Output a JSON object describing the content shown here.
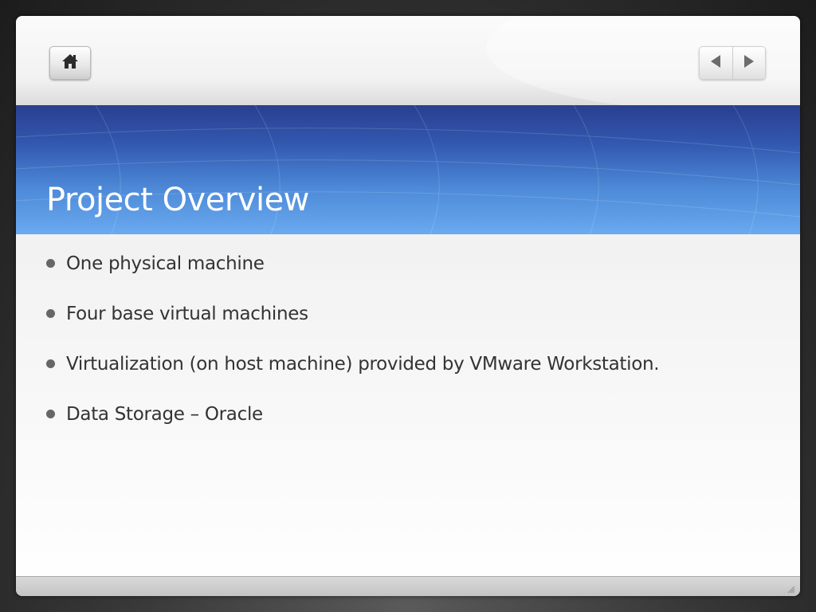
{
  "slide": {
    "title": "Project Overview",
    "bullets": [
      "One physical machine",
      "Four base virtual machines",
      "Virtualization (on host machine) provided by VMware Workstation.",
      "Data Storage – Oracle"
    ]
  },
  "toolbar": {
    "home_icon": "home-icon",
    "prev_icon": "left-arrow-icon",
    "next_icon": "right-arrow-icon"
  },
  "colors": {
    "title_band_top": "#2a3f8f",
    "title_band_bottom": "#6aaaf0",
    "title_text": "#ffffff",
    "body_text": "#333333",
    "bullet": "#666666"
  }
}
